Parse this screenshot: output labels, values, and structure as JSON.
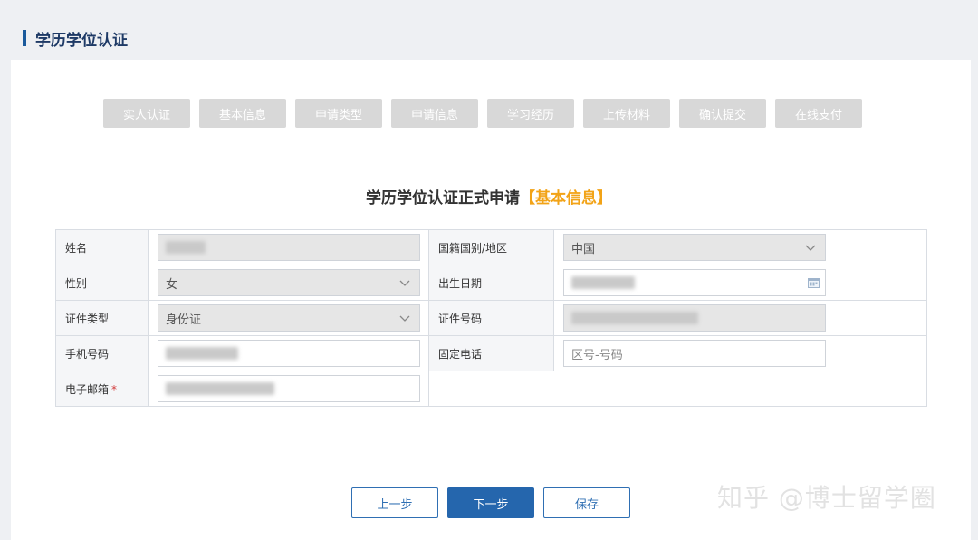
{
  "header": {
    "title": "学历学位认证"
  },
  "steps": [
    {
      "label": "实人认证"
    },
    {
      "label": "基本信息"
    },
    {
      "label": "申请类型"
    },
    {
      "label": "申请信息"
    },
    {
      "label": "学习经历"
    },
    {
      "label": "上传材料"
    },
    {
      "label": "确认提交"
    },
    {
      "label": "在线支付"
    }
  ],
  "form": {
    "title": "学历学位认证正式申请",
    "title_section": "【基本信息】",
    "fields": {
      "name": {
        "label": "姓名"
      },
      "nationality": {
        "label": "国籍国别/地区",
        "value": "中国"
      },
      "gender": {
        "label": "性别",
        "value": "女"
      },
      "birthdate": {
        "label": "出生日期"
      },
      "id_type": {
        "label": "证件类型",
        "value": "身份证"
      },
      "id_number": {
        "label": "证件号码"
      },
      "mobile": {
        "label": "手机号码"
      },
      "landline": {
        "label": "固定电话",
        "placeholder": "区号-号码"
      },
      "email": {
        "label": "电子邮箱",
        "required_mark": "*"
      }
    }
  },
  "actions": {
    "prev_label": "上一步",
    "next_label": "下一步",
    "save_label": "保存"
  },
  "watermark": {
    "text": "知乎 @博士留学圈"
  }
}
